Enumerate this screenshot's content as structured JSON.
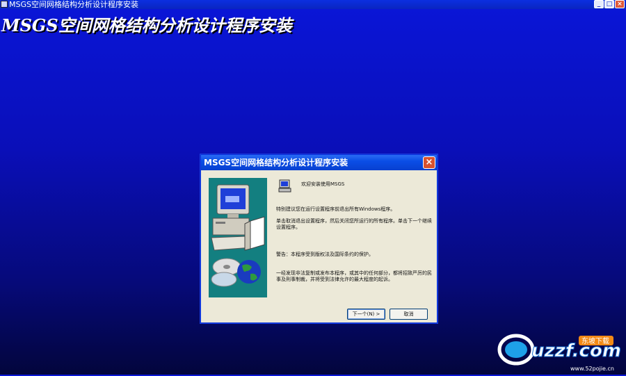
{
  "window": {
    "title": "MSGS空间网格结构分析设计程序安装",
    "banner": "MSGS空间网格结构分析设计程序安装",
    "buttons": {
      "minimize": "_",
      "maximize": "□",
      "close": "×"
    }
  },
  "dialog": {
    "title": "MSGS空间网格结构分析设计程序安装",
    "close_label": "×",
    "welcome": "欢迎安装使用MSGS",
    "paragraph1": "特别建议您在运行设置程序前退出所有Windows程序。",
    "paragraph2": "单击取消退出设置程序，然后关闭您所运行的所有程序。单击下一个继续设置程序。",
    "paragraph3": "警告：本程序受到版权法及国际条约的保护。",
    "paragraph4": "一经发现非法复制或发布本程序，或其中的任何部分，都将招致严厉的民事及刑事制裁，并将受到法律允许的最大程度的起诉。",
    "next_label": "下一个(N) >",
    "cancel_label": "取消"
  },
  "watermark": {
    "logo_text": "uzzf.com",
    "tag": "东坡下载",
    "site": "www.52pojie.cn"
  },
  "colors": {
    "desktop_top": "#0a16d8",
    "desktop_bottom": "#03053c",
    "dialog_face": "#ece9d8",
    "dialog_title": "#0a4ee6",
    "side_panel": "#137f80"
  }
}
